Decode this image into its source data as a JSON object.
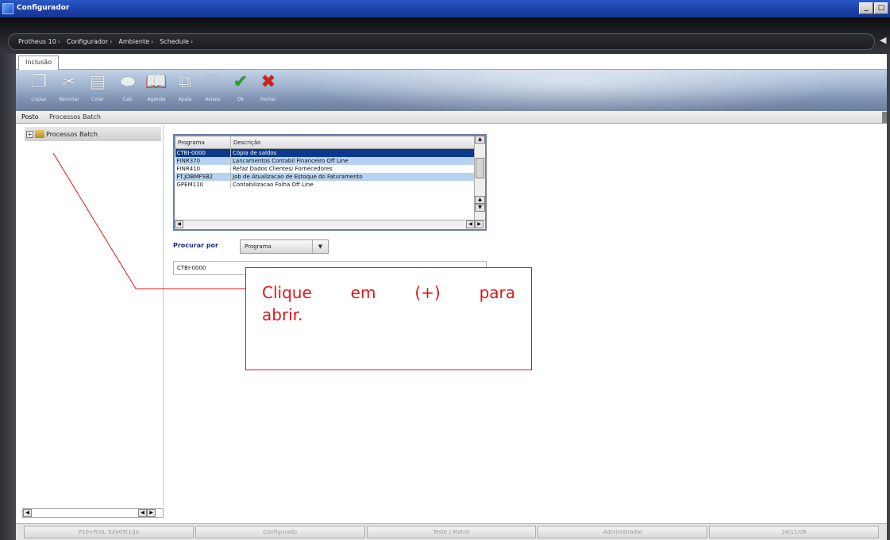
{
  "window": {
    "title": "Configurador",
    "controls": [
      "_",
      "□"
    ]
  },
  "breadcrumb": [
    {
      "label": "Protheus 10"
    },
    {
      "label": "Configurador"
    },
    {
      "label": "Ambiente"
    },
    {
      "label": "Schedule"
    }
  ],
  "tab": {
    "label": "Inclusão"
  },
  "toolbar": [
    {
      "name": "copiar",
      "label": "Copiar",
      "icon": "copy-icon"
    },
    {
      "name": "recortar",
      "label": "Recortar",
      "icon": "scissors-icon"
    },
    {
      "name": "colar",
      "label": "Colar",
      "icon": "paste-icon"
    },
    {
      "name": "calc",
      "label": "Calc",
      "icon": "eraser-icon"
    },
    {
      "name": "agenda",
      "label": "Agenda",
      "icon": "book-icon"
    },
    {
      "name": "ajuda",
      "label": "Ajuda",
      "icon": "help-icon"
    },
    {
      "name": "avisos",
      "label": "Avisos",
      "icon": "heart-icon"
    },
    {
      "name": "ok",
      "label": "Ok",
      "icon": "check-icon"
    },
    {
      "name": "fechar",
      "label": "Fechar",
      "icon": "close-icon"
    }
  ],
  "subtabs": {
    "first": "Posto",
    "second": "Processos Batch"
  },
  "tree": {
    "node_label": "Processos Batch",
    "expander": "+"
  },
  "grid": {
    "columns": [
      "Programa",
      "Descrição"
    ],
    "rows": [
      {
        "programa": "CTBI-0000",
        "descricao": "Cópia de saldos"
      },
      {
        "programa": "FINR370",
        "descricao": "Lancamentos Contabil Financeiro Off Line"
      },
      {
        "programa": "FINR410",
        "descricao": "Refaz Dados Clientes/ Fornecedores"
      },
      {
        "programa": "FT.JOBMFSB2",
        "descricao": "Job de Atualizacao de Estoque do Faturamento"
      },
      {
        "programa": "GPEM110",
        "descricao": "Contabilizacao Folha Off Line"
      }
    ]
  },
  "search": {
    "label": "Procurar por",
    "selected": "Programa",
    "value": "CTBI-0000"
  },
  "callout": {
    "line1": [
      "Clique",
      "em",
      "(+)",
      "para"
    ],
    "line2": "abrir."
  },
  "statusbar": [
    "P10+R0IL Tufe09(1)Ja",
    "Configurado",
    "Teste / Matriz",
    "Administrador",
    "24/11/08"
  ]
}
